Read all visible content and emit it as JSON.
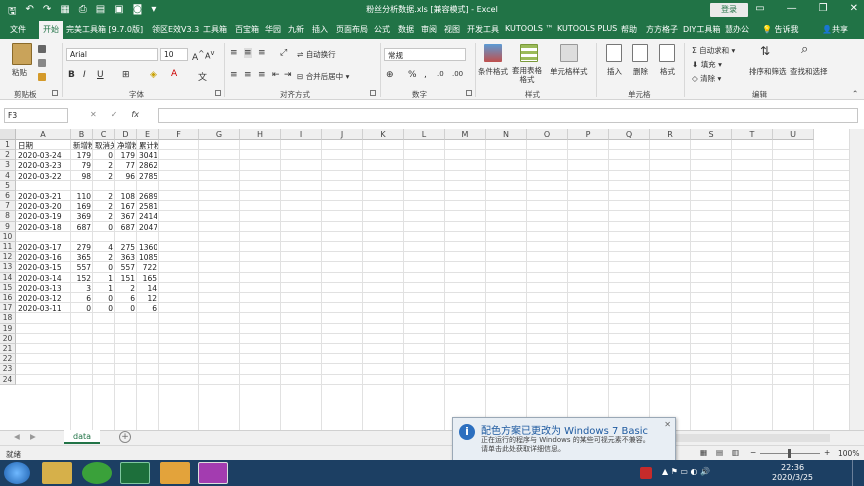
{
  "window": {
    "title": "粉丝分析数据.xls  [兼容模式]  -  Excel",
    "login_label": "登录",
    "minimize": "—",
    "restore": "❐",
    "close": "✕"
  },
  "ribbon_tabs": [
    "文件",
    "开始",
    "完美工具箱 [9.7.0版]",
    "领区E效V3.3",
    "工具箱",
    "百宝箱",
    "华园",
    "九新",
    "插入",
    "页面布局",
    "公式",
    "数据",
    "审阅",
    "视图",
    "开发工具",
    "KUTOOLS ™",
    "KUTOOLS PLUS",
    "帮助",
    "方方格子",
    "DIY工具箱",
    "慧办公"
  ],
  "tell_me": "告诉我",
  "share": "共享",
  "ribbon": {
    "paste": "粘贴",
    "clipboard": "剪贴板",
    "font_name": "Arial",
    "font_size": "10",
    "font_group": "字体",
    "wrap_text": "自动换行",
    "merge_center": "合并后居中",
    "alignment_group": "对齐方式",
    "number_format": "常规",
    "number_group": "数字",
    "cond_format": "条件格式",
    "table_format": "套用表格格式",
    "cell_style": "单元格样式",
    "styles_group": "样式",
    "insert": "插入",
    "delete": "删除",
    "format": "格式",
    "cells_group": "单元格",
    "autosum": "自动求和",
    "fill": "填充",
    "clear": "清除",
    "sort_filter": "排序和筛选",
    "find_select": "查找和选择",
    "editing_group": "编辑"
  },
  "formula_bar": {
    "name_box": "F3",
    "cancel": "✕",
    "enter": "✓",
    "fx": "fx",
    "value": ""
  },
  "columns": [
    "A",
    "B",
    "C",
    "D",
    "E",
    "F",
    "G",
    "H",
    "I",
    "J",
    "K",
    "L",
    "M",
    "N",
    "O",
    "P",
    "Q",
    "R",
    "S",
    "T",
    "U"
  ],
  "rows": [
    "1",
    "2",
    "3",
    "4",
    "5",
    "6",
    "7",
    "8",
    "9",
    "10",
    "11",
    "12",
    "13",
    "14",
    "15",
    "16",
    "17",
    "18",
    "19",
    "20",
    "21",
    "22",
    "23",
    "24"
  ],
  "headers": [
    "日期",
    "新增粉",
    "取消关注",
    "净增粉",
    "累计粉丝"
  ],
  "data_rows": [
    [
      "2020-03-24",
      "179",
      "0",
      "179",
      "3041"
    ],
    [
      "2020-03-23",
      "79",
      "2",
      "77",
      "2862"
    ],
    [
      "2020-03-22",
      "98",
      "2",
      "96",
      "2785"
    ],
    [
      "",
      "",
      "",
      "",
      ""
    ],
    [
      "2020-03-21",
      "110",
      "2",
      "108",
      "2689"
    ],
    [
      "2020-03-20",
      "169",
      "2",
      "167",
      "2581"
    ],
    [
      "2020-03-19",
      "369",
      "2",
      "367",
      "2414"
    ],
    [
      "2020-03-18",
      "687",
      "0",
      "687",
      "2047"
    ],
    [
      "",
      "",
      "",
      "",
      ""
    ],
    [
      "2020-03-17",
      "279",
      "4",
      "275",
      "1360"
    ],
    [
      "2020-03-16",
      "365",
      "2",
      "363",
      "1085"
    ],
    [
      "2020-03-15",
      "557",
      "0",
      "557",
      "722"
    ],
    [
      "2020-03-14",
      "152",
      "1",
      "151",
      "165"
    ],
    [
      "2020-03-13",
      "3",
      "1",
      "2",
      "14"
    ],
    [
      "2020-03-12",
      "6",
      "0",
      "6",
      "12"
    ],
    [
      "2020-03-11",
      "0",
      "0",
      "0",
      "6"
    ]
  ],
  "sheet_tab": "data",
  "add_sheet": "+",
  "status": {
    "ready": "就绪",
    "zoom": "100%"
  },
  "taskbar": {
    "time": "22:36",
    "date": "2020/3/25"
  },
  "notification": {
    "title": "配色方案已更改为 Windows 7 Basic",
    "message_line1": "正在运行的程序与 Windows 的某些可视元素不兼容。",
    "message_line2": "请单击此处获取详细信息。",
    "close": "✕"
  },
  "colors": {
    "excel_green": "#217346",
    "taskbar": "#1c3f63"
  }
}
